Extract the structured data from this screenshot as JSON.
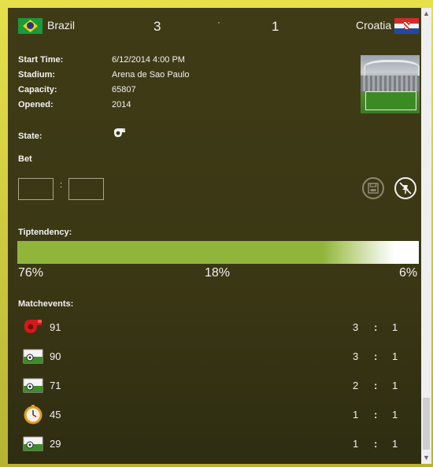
{
  "header": {
    "home_team": "Brazil",
    "home_score": "3",
    "separator": "·",
    "away_score": "1",
    "away_team": "Croatia"
  },
  "info": {
    "start_time_label": "Start Time:",
    "start_time_value": "6/12/2014 4:00 PM",
    "stadium_label": "Stadium:",
    "stadium_value": "Arena de Sao Paulo",
    "capacity_label": "Capacity:",
    "capacity_value": "65807",
    "opened_label": "Opened:",
    "opened_value": "2014"
  },
  "state": {
    "label": "State:",
    "icon": "whistle-icon"
  },
  "bet": {
    "label": "Bet",
    "home_value": "",
    "away_value": "",
    "colon": ":"
  },
  "tendency": {
    "label": "Tiptendency:",
    "home_pct": "76%",
    "draw_pct": "18%",
    "away_pct": "6%"
  },
  "events": {
    "label": "Matchevents:",
    "colon": ":",
    "items": [
      {
        "icon": "red-whistle-icon",
        "minute": "91",
        "home": "3",
        "away": "1"
      },
      {
        "icon": "goal-icon",
        "minute": "90",
        "home": "3",
        "away": "1"
      },
      {
        "icon": "goal-icon",
        "minute": "71",
        "home": "2",
        "away": "1"
      },
      {
        "icon": "stopwatch-icon",
        "minute": "45",
        "home": "1",
        "away": "1"
      },
      {
        "icon": "goal-icon",
        "minute": "29",
        "home": "1",
        "away": "1"
      }
    ]
  },
  "colors": {
    "panel": "#3c3915",
    "frame": "#d8d240",
    "tendency_green": "#8fb63b"
  }
}
